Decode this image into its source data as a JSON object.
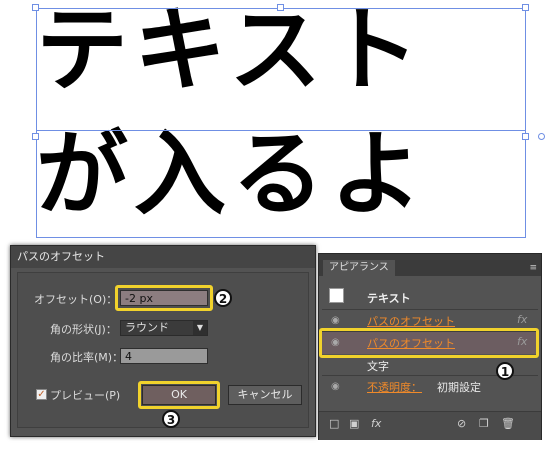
{
  "canvas": {
    "line1": "テキスト",
    "line2": "が入るよ"
  },
  "dialog": {
    "title": "パスのオフセット",
    "offset_label": "オフセット(O)：",
    "offset_value": "-2 px",
    "join_label": "角の形状(J)：",
    "join_value": "ラウンド",
    "miter_label": "角の比率(M)：",
    "miter_value": "4",
    "preview_label": "プレビュー(P)",
    "preview_checked": true,
    "ok_label": "OK",
    "cancel_label": "キャンセル"
  },
  "panel": {
    "tab_label": "アピアランス",
    "header_label": "テキスト",
    "effect1_label": "パスのオフセット",
    "effect2_label": "パスのオフセット",
    "fx_glyph": "fx",
    "char_label": "文字",
    "opacity_label": "不透明度：",
    "opacity_value": "初期設定"
  },
  "callouts": {
    "c1": "1",
    "c2": "2",
    "c3": "3"
  },
  "colors": {
    "highlight": "#f1d22c",
    "selection": "#6f8fe4",
    "link_orange": "#f08a2a"
  }
}
